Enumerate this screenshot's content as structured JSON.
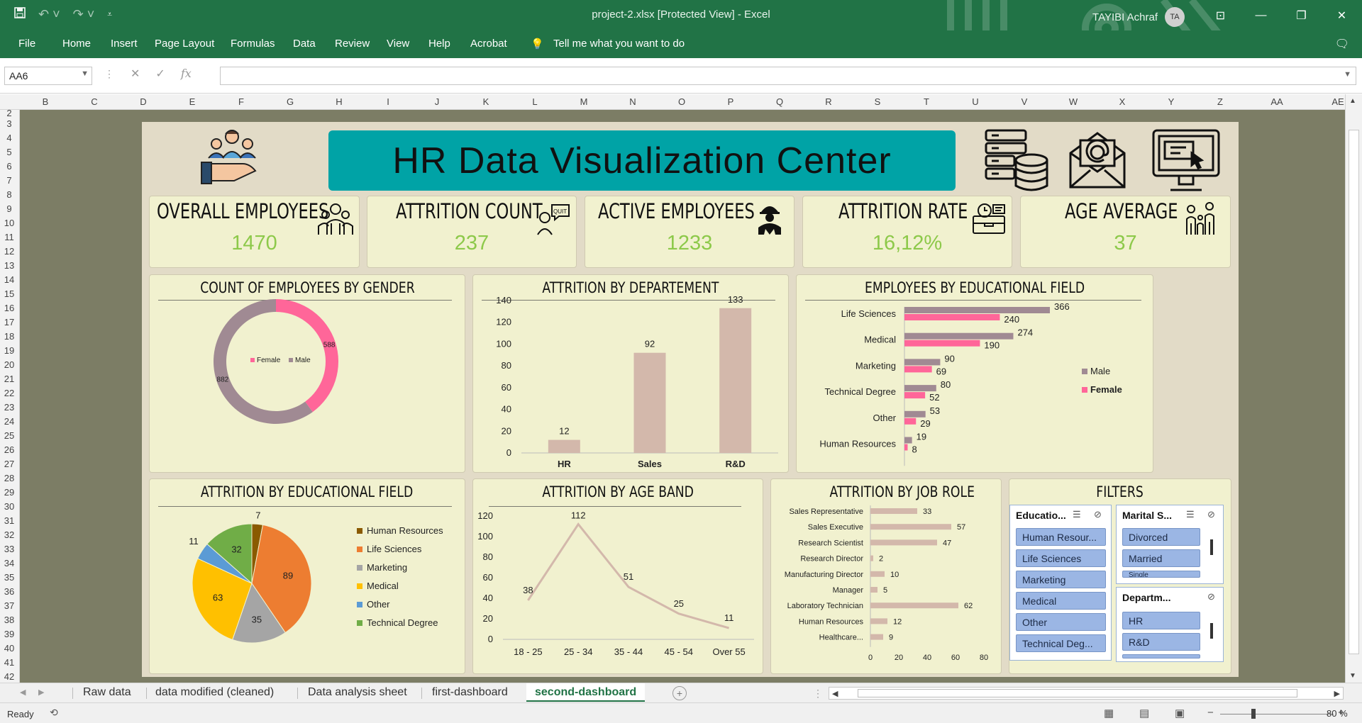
{
  "window": {
    "doc_title": "project-2.xlsx  [Protected View]  -  Excel",
    "user_name": "TAYIBI Achraf",
    "user_initials": "TA"
  },
  "ribbon_tabs": [
    "File",
    "Home",
    "Insert",
    "Page Layout",
    "Formulas",
    "Data",
    "Review",
    "View",
    "Help",
    "Acrobat"
  ],
  "tell_me": "Tell me what you want to do",
  "formula_bar": {
    "name_box": "AA6",
    "fx": "fx",
    "value": ""
  },
  "columns": [
    "B",
    "C",
    "D",
    "E",
    "F",
    "G",
    "H",
    "I",
    "J",
    "K",
    "L",
    "M",
    "N",
    "O",
    "P",
    "Q",
    "R",
    "S",
    "T",
    "U",
    "V",
    "W",
    "X",
    "Y",
    "Z",
    "AA",
    "AE"
  ],
  "rows": [
    "2",
    "3",
    "4",
    "5",
    "6",
    "7",
    "8",
    "9",
    "10",
    "11",
    "12",
    "13",
    "14",
    "15",
    "16",
    "17",
    "18",
    "19",
    "20",
    "21",
    "22",
    "23",
    "24",
    "25",
    "26",
    "27",
    "28",
    "29",
    "30",
    "31",
    "32",
    "33",
    "34",
    "35",
    "36",
    "37",
    "38",
    "39",
    "40",
    "41",
    "42"
  ],
  "dashboard": {
    "title": "HR Data Visualization Center",
    "kpis": [
      {
        "label": "OVERALL EMPLOYEES",
        "value": "1470",
        "icon": "employees-group-icon"
      },
      {
        "label": "ATTRITION COUNT",
        "value": "237",
        "icon": "quit-person-icon"
      },
      {
        "label": "ACTIVE EMPLOYEES",
        "value": "1233",
        "icon": "worker-icon"
      },
      {
        "label": "ATTRITION RATE",
        "value": "16,12%",
        "icon": "briefcase-clock-icon"
      },
      {
        "label": "AGE AVERAGE",
        "value": "37",
        "icon": "family-icon"
      }
    ],
    "panels": {
      "gender": "COUNT OF EMPLOYEES BY GENDER",
      "department": "ATTRITION BY DEPARTEMENT",
      "edu_field": "EMPLOYEES BY EDUCATIONAL FIELD",
      "attr_edu": "ATTRITION BY  EDUCATIONAL FIELD",
      "age_band": "ATTRITION BY  AGE BAND",
      "job_role": "ATTRITION BY  JOB ROLE",
      "filters": "FILTERS"
    },
    "slicers": {
      "education": {
        "header": "Educatio...",
        "items": [
          "Human Resour...",
          "Life Sciences",
          "Marketing",
          "Medical",
          "Other",
          "Technical Deg..."
        ]
      },
      "marital": {
        "header": "Marital S...",
        "items": [
          "Divorced",
          "Married",
          "Single"
        ]
      },
      "department": {
        "header": "Departm...",
        "items": [
          "HR",
          "R&D"
        ]
      }
    }
  },
  "chart_data": [
    {
      "id": "gender",
      "type": "pie",
      "variant": "donut",
      "labels": [
        "Female",
        "Male"
      ],
      "values": [
        588,
        882
      ],
      "colors": [
        "#ff6699",
        "#a08a93"
      ],
      "legend": "center"
    },
    {
      "id": "department",
      "type": "bar",
      "categories": [
        "HR",
        "Sales",
        "R&D"
      ],
      "values": [
        12,
        92,
        133
      ],
      "ylim": [
        0,
        140
      ],
      "yticks": [
        0,
        20,
        40,
        60,
        80,
        100,
        120,
        140
      ],
      "color": "#d3b8ab"
    },
    {
      "id": "edu_field",
      "type": "bar",
      "orientation": "horizontal",
      "categories": [
        "Life Sciences",
        "Medical",
        "Marketing",
        "Technical Degree",
        "Other",
        "Human Resources"
      ],
      "series": [
        {
          "name": "Male",
          "values": [
            366,
            274,
            90,
            80,
            53,
            19
          ],
          "color": "#a08a93"
        },
        {
          "name": "Female",
          "values": [
            240,
            190,
            69,
            52,
            29,
            8
          ],
          "color": "#ff6699"
        }
      ],
      "legend": "right"
    },
    {
      "id": "attr_edu",
      "type": "pie",
      "labels": [
        "Human Resources",
        "Life Sciences",
        "Marketing",
        "Medical",
        "Other",
        "Technical Degree"
      ],
      "values": [
        7,
        89,
        35,
        63,
        11,
        32
      ],
      "colors": [
        "#8a5a00",
        "#ed7d31",
        "#a5a5a5",
        "#ffc000",
        "#5b9bd5",
        "#70ad47"
      ],
      "legend": "right"
    },
    {
      "id": "age_band",
      "type": "line",
      "categories": [
        "18 - 25",
        "25 - 34",
        "35 - 44",
        "45 - 54",
        "Over 55"
      ],
      "values": [
        38,
        112,
        51,
        25,
        11
      ],
      "ylim": [
        0,
        120
      ],
      "yticks": [
        0,
        20,
        40,
        60,
        80,
        100,
        120
      ],
      "color": "#d3b8ab"
    },
    {
      "id": "job_role",
      "type": "bar",
      "orientation": "horizontal",
      "categories": [
        "Sales Representative",
        "Sales Executive",
        "Research Scientist",
        "Research Director",
        "Manufacturing Director",
        "Manager",
        "Laboratory Technician",
        "Human Resources",
        "Healthcare..."
      ],
      "values": [
        33,
        57,
        47,
        2,
        10,
        5,
        62,
        12,
        9
      ],
      "xlim": [
        0,
        80
      ],
      "xticks": [
        0,
        20,
        40,
        60,
        80
      ],
      "color": "#d3b8ab"
    }
  ],
  "sheet_tabs": [
    "Raw data",
    "data modified (cleaned)",
    "Data analysis sheet",
    "first-dashboard",
    "second-dashboard"
  ],
  "active_tab": "second-dashboard",
  "status": {
    "ready": "Ready",
    "zoom": "80 %"
  }
}
